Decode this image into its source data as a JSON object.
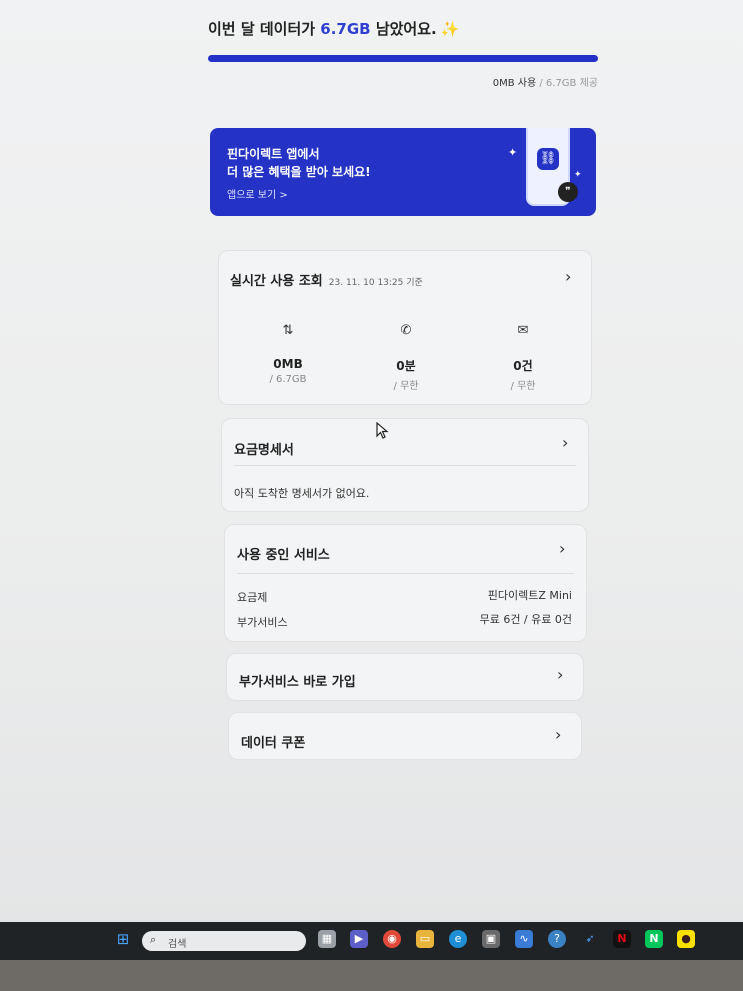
{
  "summary": {
    "prefix": "이번 달 데이터가 ",
    "amount": "6.7GB",
    "suffix": " 남았어요.",
    "used_label": "0MB 사용",
    "provided_label": " / 6.7GB 제공"
  },
  "banner": {
    "line1": "핀다이렉트 앱에서",
    "line2": "더 많은 혜택을 받아 보세요!",
    "cta": "앱으로 보기 >"
  },
  "realtime": {
    "title": "실시간 사용 조회",
    "timestamp": "23. 11. 10 13:25 기준",
    "stats": [
      {
        "icon": "data-transfer-icon",
        "value": "0MB",
        "limit": "/ 6.7GB"
      },
      {
        "icon": "phone-icon",
        "value": "0분",
        "limit": "/ 무한"
      },
      {
        "icon": "mail-icon",
        "value": "0건",
        "limit": "/ 무한"
      }
    ]
  },
  "bill": {
    "title": "요금명세서",
    "message": "아직 도착한 명세서가 없어요."
  },
  "services": {
    "title": "사용 중인 서비스",
    "rows": [
      {
        "label": "요금제",
        "value": "핀다이렉트Z Mini"
      },
      {
        "label": "부가서비스",
        "value": "무료 6건 / 유료 0건"
      }
    ]
  },
  "addon": {
    "title": "부가서비스 바로 가입"
  },
  "coupon": {
    "title": "데이터 쿠폰"
  },
  "taskbar": {
    "search_placeholder": "검색"
  },
  "colors": {
    "accent": "#2433c6",
    "highlight": "#2f3fd0"
  }
}
